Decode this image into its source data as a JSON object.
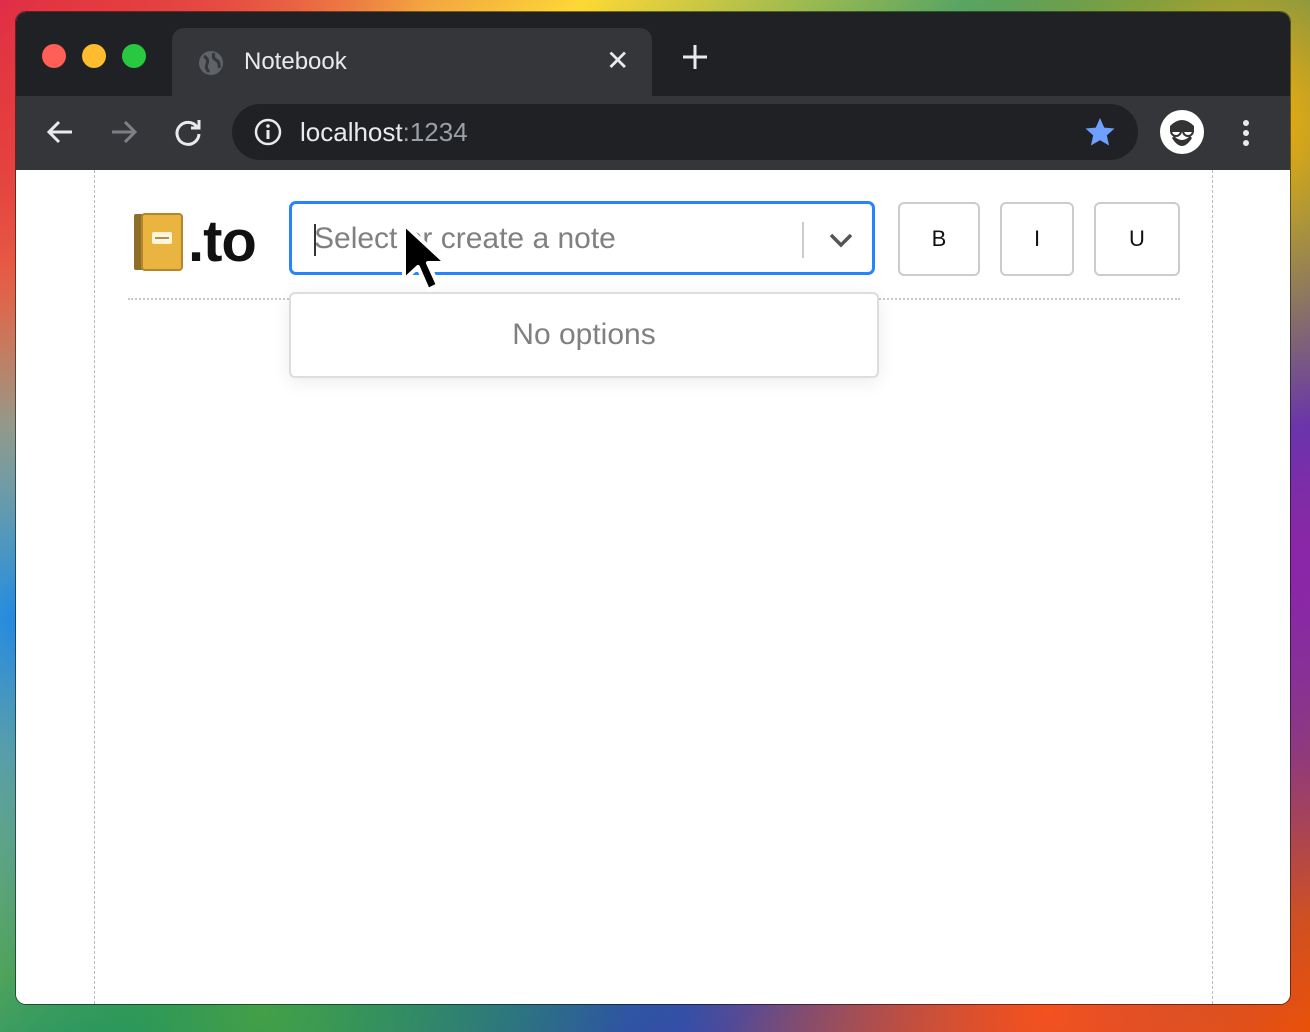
{
  "browser": {
    "tab": {
      "title": "Notebook",
      "close_label": "✕"
    },
    "address": {
      "host": "localhost",
      "port": ":1234"
    },
    "colors": {
      "bookmark_star": "#6ea1ff",
      "focus_ring": "#2684ff"
    }
  },
  "app": {
    "logo": {
      "emoji_name": "notebook-icon",
      "text": ".to"
    },
    "note_select": {
      "placeholder": "Select or create a note",
      "menu_message": "No options"
    },
    "format_buttons": {
      "bold": "B",
      "italic": "I",
      "underline": "U"
    }
  }
}
